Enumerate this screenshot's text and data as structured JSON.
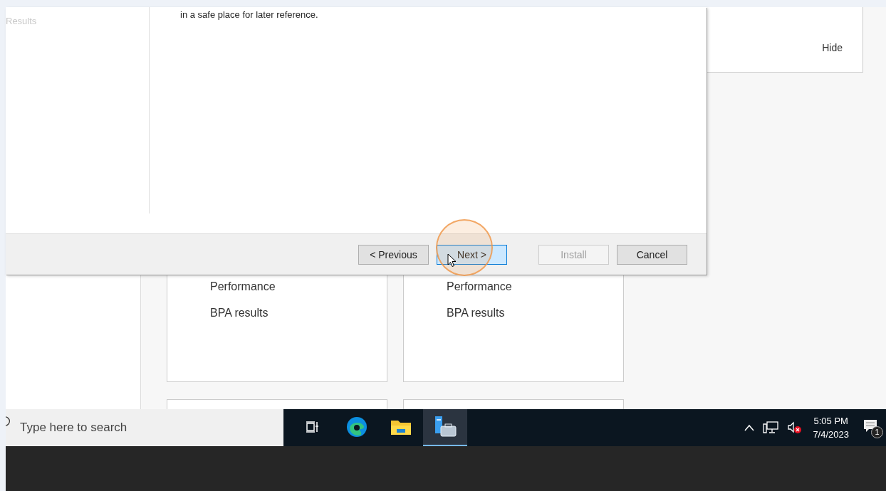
{
  "server_manager": {
    "tiles": [
      {
        "lines": [
          "Performance",
          "BPA results"
        ]
      },
      {
        "lines": [
          "Performance",
          "BPA results"
        ]
      }
    ],
    "hide_link": "Hide"
  },
  "wizard": {
    "steps": [
      {
        "label": "Results",
        "disabled": true
      }
    ],
    "message": "in a safe place for later reference.",
    "buttons": [
      {
        "label": "< Previous",
        "disabled": false,
        "focused": false
      },
      {
        "label": "Next >",
        "disabled": false,
        "focused": true
      },
      {
        "label": "Install",
        "disabled": true,
        "focused": false
      },
      {
        "label": "Cancel",
        "disabled": false,
        "focused": false
      }
    ]
  },
  "taskbar": {
    "search": {
      "placeholder": "Type here to search"
    },
    "apps": [
      {
        "kind": "task-view",
        "selected": false
      },
      {
        "kind": "browser",
        "selected": false
      },
      {
        "kind": "folder",
        "selected": false
      },
      {
        "kind": "server",
        "selected": true
      }
    ],
    "time": "5:05 PM",
    "date": "7/4/2023",
    "notification_count": "1"
  }
}
